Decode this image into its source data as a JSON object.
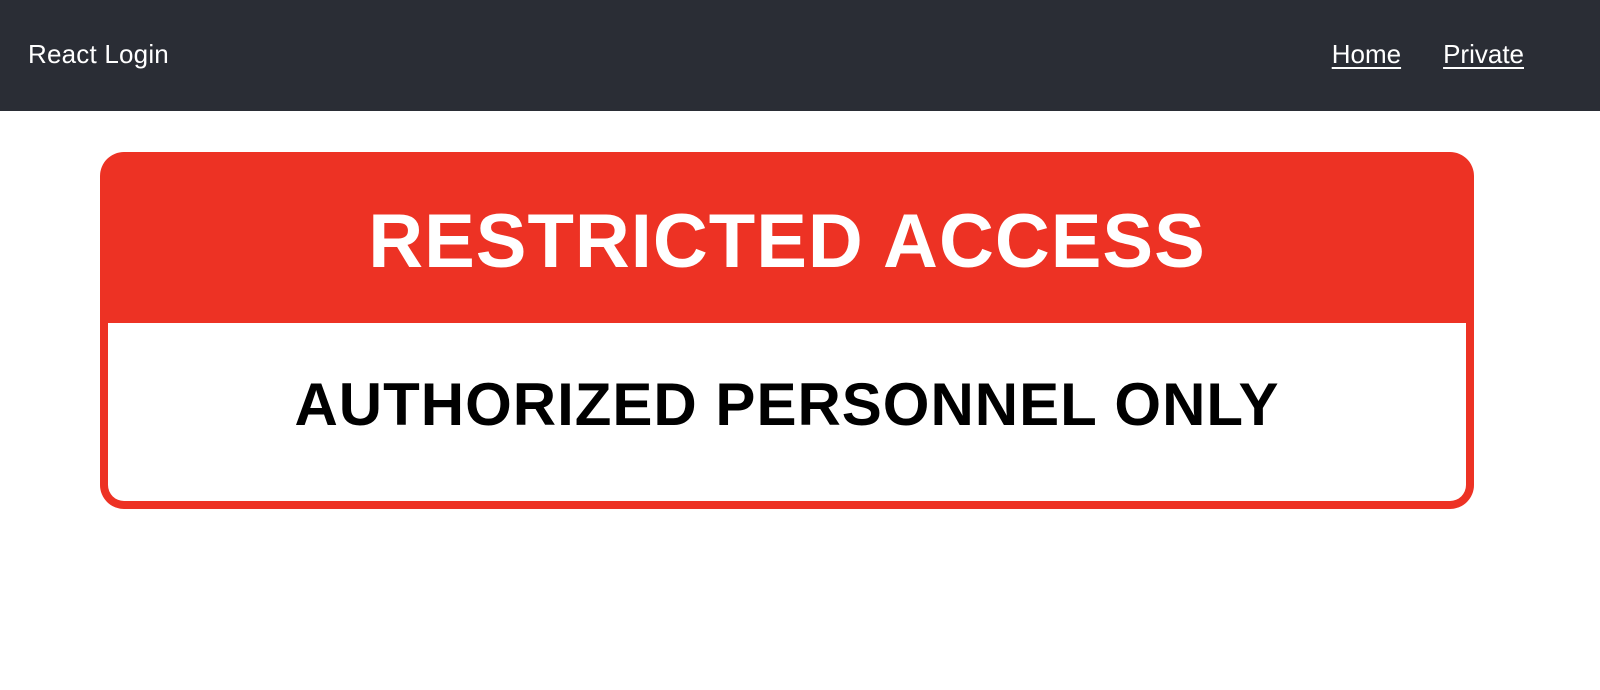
{
  "navbar": {
    "brand": "React Login",
    "links": [
      {
        "label": "Home"
      },
      {
        "label": "Private"
      }
    ]
  },
  "sign": {
    "title": "RESTRICTED ACCESS",
    "subtitle": "AUTHORIZED PERSONNEL ONLY"
  },
  "colors": {
    "navbar_bg": "#2a2d35",
    "sign_red": "#ed3224",
    "white": "#ffffff",
    "text_black": "#000000"
  }
}
